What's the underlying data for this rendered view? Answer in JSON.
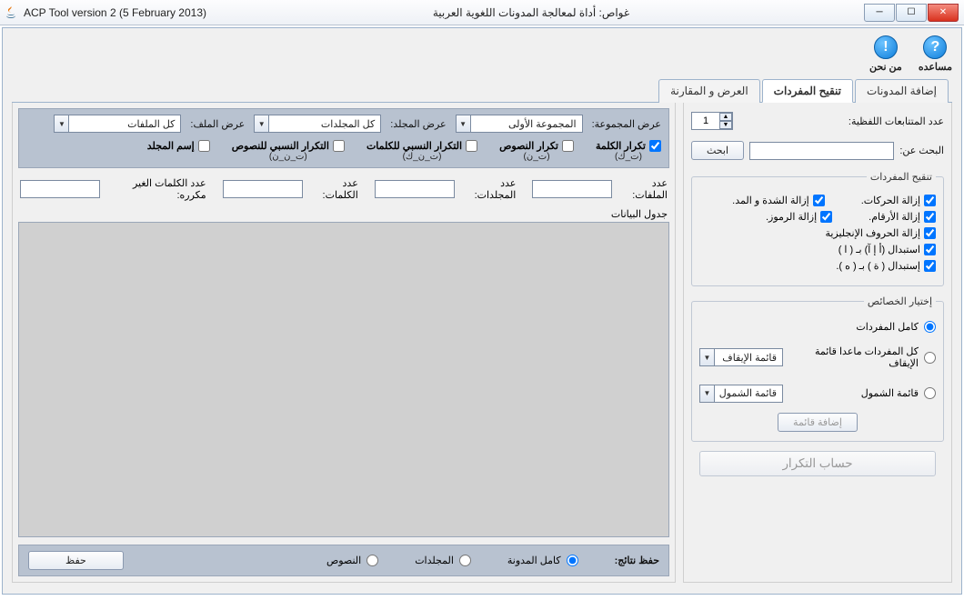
{
  "titlebar": {
    "title_en": "ACP Tool version 2 (5 February 2013)",
    "title_ar": "غواص: أداة لمعالجة المدونات اللغوية العربية"
  },
  "help": {
    "help_label": "مساعده",
    "about_label": "من نحن"
  },
  "tabs": {
    "add_corpora": "إضافة المدونات",
    "refine_vocab": "تنقيح المفردات",
    "view_compare": "العرض و المقارنة"
  },
  "right": {
    "ngram_label": "عدد المتتابعات اللفظية:",
    "ngram_value": "1",
    "search_label": "البحث عن:",
    "search_btn": "ابحث",
    "vocab_legend": "تنقيح المفردات",
    "remove_harakat": "إزالة الحركات.",
    "remove_shadda": "إزالة الشدة و المد.",
    "remove_digits": "إزالة الأرقام.",
    "remove_symbols": "إزالة الرموز.",
    "remove_english": "إزالة الحروف الإنجليزية",
    "replace_alef": "استبدال (أ إ آ) بـ ( ا )",
    "replace_ta": "إستبدال ( ة ) بـ ( ه ).",
    "props_legend": "إختيار الخصائص",
    "all_vocab": "كامل المفردات",
    "except_stop": "كل المفردات ماعدا قائمة الإيقاف",
    "stop_list": "قائمة الإيقاف",
    "include_list": "قائمة الشمول",
    "include_list_combo": "قائمة الشمول",
    "add_list_btn": "إضافة قائمة",
    "calc_btn": "حساب التكرار"
  },
  "left": {
    "group_label": "عرض المجموعة:",
    "group_value": "المجموعة الأولى",
    "folder_label": "عرض المجلد:",
    "folder_value": "كل المجلدات",
    "file_label": "عرض الملف:",
    "file_value": "كل الملفات",
    "chk_word_freq": "تكرار الكلمة",
    "chk_word_freq_sub": "(ت_ك)",
    "chk_text_freq": "تكرار النصوص",
    "chk_text_freq_sub": "(ت_ن)",
    "chk_rel_word": "التكرار النسبي للكلمات",
    "chk_rel_word_sub": "(ت_ن_ك)",
    "chk_rel_text": "التكرار النسبي للنصوص",
    "chk_rel_text_sub": "(ت_ن_ن)",
    "chk_folder_name": "إسم المجلد",
    "files_count": "عدد الملفات:",
    "folders_count": "عدد المجلدات:",
    "words_count": "عدد الكلمات:",
    "unique_words": "عدد الكلمات الغير مكرره:",
    "data_table": "جدول البيانات",
    "save_results": "حفظ نتائج:",
    "full_corpus": "كامل المدونة",
    "folders": "المجلدات",
    "texts": "النصوص",
    "save_btn": "حفظ"
  }
}
